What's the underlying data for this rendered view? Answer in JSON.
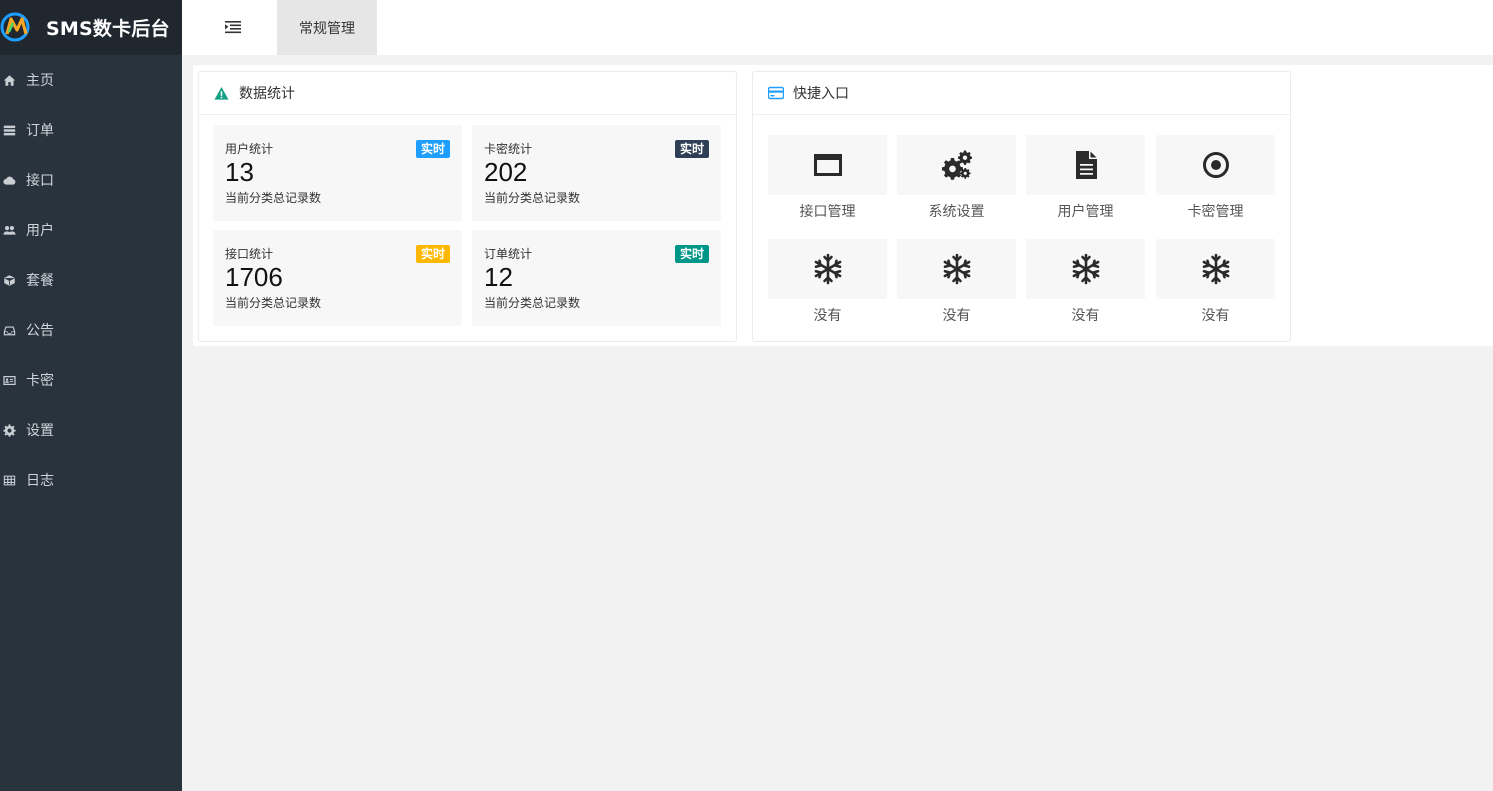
{
  "app": {
    "title": "SMS数卡后台"
  },
  "sidebar": {
    "items": [
      {
        "label": "主页",
        "icon": "home-icon"
      },
      {
        "label": "订单",
        "icon": "server-icon"
      },
      {
        "label": "接口",
        "icon": "cloud-icon"
      },
      {
        "label": "用户",
        "icon": "users-icon"
      },
      {
        "label": "套餐",
        "icon": "cube-icon"
      },
      {
        "label": "公告",
        "icon": "inbox-icon"
      },
      {
        "label": "卡密",
        "icon": "id-card-icon"
      },
      {
        "label": "设置",
        "icon": "gear-icon"
      },
      {
        "label": "日志",
        "icon": "table-icon"
      }
    ]
  },
  "header": {
    "tab_label": "常规管理"
  },
  "stats_panel": {
    "title": "数据统计",
    "cards": [
      {
        "label": "用户统计",
        "value": "13",
        "badge": "实时",
        "badge_color": "#1e9fff",
        "desc": "当前分类总记录数"
      },
      {
        "label": "卡密统计",
        "value": "202",
        "badge": "实时",
        "badge_color": "#2f4056",
        "desc": "当前分类总记录数"
      },
      {
        "label": "接口统计",
        "value": "1706",
        "badge": "实时",
        "badge_color": "#ffb800",
        "desc": "当前分类总记录数"
      },
      {
        "label": "订单统计",
        "value": "12",
        "badge": "实时",
        "badge_color": "#009688",
        "desc": "当前分类总记录数"
      }
    ]
  },
  "quick_panel": {
    "title": "快捷入口",
    "items": [
      {
        "label": "接口管理",
        "icon": "window-icon"
      },
      {
        "label": "系统设置",
        "icon": "gears-icon"
      },
      {
        "label": "用户管理",
        "icon": "file-text-icon"
      },
      {
        "label": "卡密管理",
        "icon": "dot-circle-icon"
      },
      {
        "label": "没有",
        "icon": "snowflake-icon"
      },
      {
        "label": "没有",
        "icon": "snowflake-icon"
      },
      {
        "label": "没有",
        "icon": "snowflake-icon"
      },
      {
        "label": "没有",
        "icon": "snowflake-icon"
      }
    ]
  },
  "colors": {
    "sidebar_bg": "#28333e",
    "logo_bg": "#20272f",
    "page_bg": "#f2f2f2",
    "panel_icon_green": "#16a085",
    "panel_icon_blue": "#1e9fff"
  }
}
